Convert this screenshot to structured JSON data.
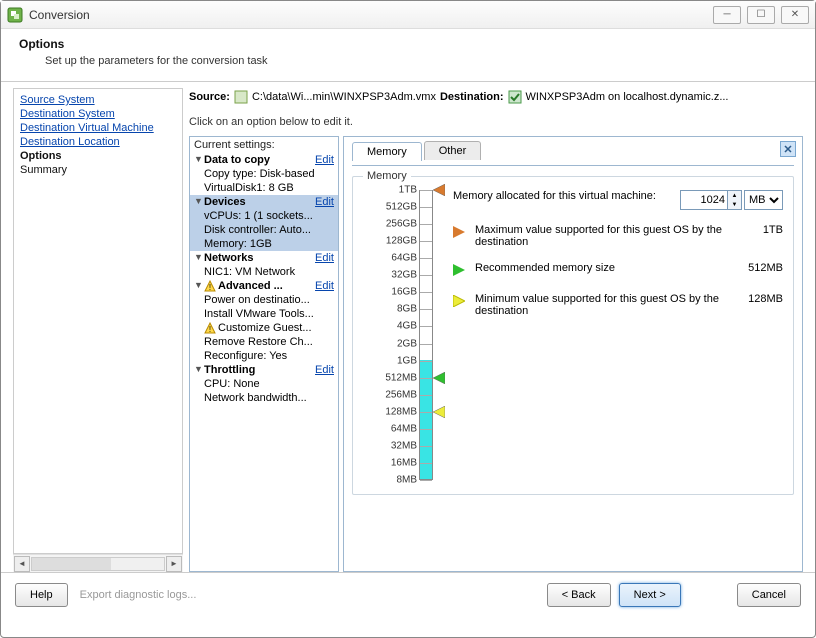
{
  "window": {
    "title": "Conversion"
  },
  "header": {
    "title": "Options",
    "subtitle": "Set up the parameters for the conversion task"
  },
  "nav": {
    "links": [
      "Source System",
      "Destination System",
      "Destination Virtual Machine",
      "Destination Location"
    ],
    "current": "Options",
    "remaining": "Summary"
  },
  "srcdest": {
    "source_label": "Source:",
    "source_path": "C:\\data\\Wi...min\\WINXPSP3Adm.vmx",
    "dest_label": "Destination:",
    "dest_text": "WINXPSP3Adm on localhost.dynamic.z..."
  },
  "instruction": "Click on an option below to edit it.",
  "settings": {
    "header": "Current settings:",
    "edit_label": "Edit",
    "groups": {
      "data_to_copy": {
        "title": "Data to copy",
        "items": [
          "Copy type: Disk-based",
          "VirtualDisk1: 8 GB"
        ]
      },
      "devices": {
        "title": "Devices",
        "items": [
          "vCPUs: 1 (1 sockets...",
          "Disk controller: Auto...",
          "Memory: 1GB"
        ]
      },
      "networks": {
        "title": "Networks",
        "items": [
          "NIC1: VM Network"
        ]
      },
      "advanced": {
        "title": "Advanced ...",
        "items": [
          "Power on destinatio...",
          "Install VMware Tools...",
          "Customize Guest...",
          "Remove Restore Ch...",
          "Reconfigure: Yes"
        ]
      },
      "throttling": {
        "title": "Throttling",
        "items": [
          "CPU: None",
          "Network bandwidth..."
        ]
      }
    }
  },
  "tabs": {
    "memory": "Memory",
    "other": "Other"
  },
  "memory": {
    "legend": "Memory",
    "alloc_label": "Memory allocated for this virtual machine:",
    "value": "1024",
    "unit": "MB",
    "max_label": "Maximum value supported for this guest OS by the destination",
    "max_value": "1TB",
    "rec_label": "Recommended memory size",
    "rec_value": "512MB",
    "min_label": "Minimum value supported for this guest OS by the destination",
    "min_value": "128MB",
    "ticks": [
      "1TB",
      "512GB",
      "256GB",
      "128GB",
      "64GB",
      "32GB",
      "16GB",
      "8GB",
      "4GB",
      "2GB",
      "1GB",
      "512MB",
      "256MB",
      "128MB",
      "64MB",
      "32MB",
      "16MB",
      "8MB"
    ]
  },
  "footer": {
    "help": "Help",
    "export_placeholder": "Export diagnostic logs...",
    "back": "< Back",
    "next": "Next >",
    "cancel": "Cancel"
  },
  "chart_data": {
    "type": "bar",
    "title": "Memory",
    "orientation": "vertical-slider",
    "ticks": [
      "1TB",
      "512GB",
      "256GB",
      "128GB",
      "64GB",
      "32GB",
      "16GB",
      "8GB",
      "4GB",
      "2GB",
      "1GB",
      "512MB",
      "256MB",
      "128MB",
      "64MB",
      "32MB",
      "16MB",
      "8MB"
    ],
    "current_value_mb": 1024,
    "fill_to_tick": "1GB",
    "markers": [
      {
        "name": "maximum",
        "tick": "1TB",
        "color": "#d87a2e"
      },
      {
        "name": "recommended",
        "tick": "512MB",
        "color": "#2fbf2f"
      },
      {
        "name": "minimum",
        "tick": "128MB",
        "color": "#ecec3a"
      }
    ]
  }
}
